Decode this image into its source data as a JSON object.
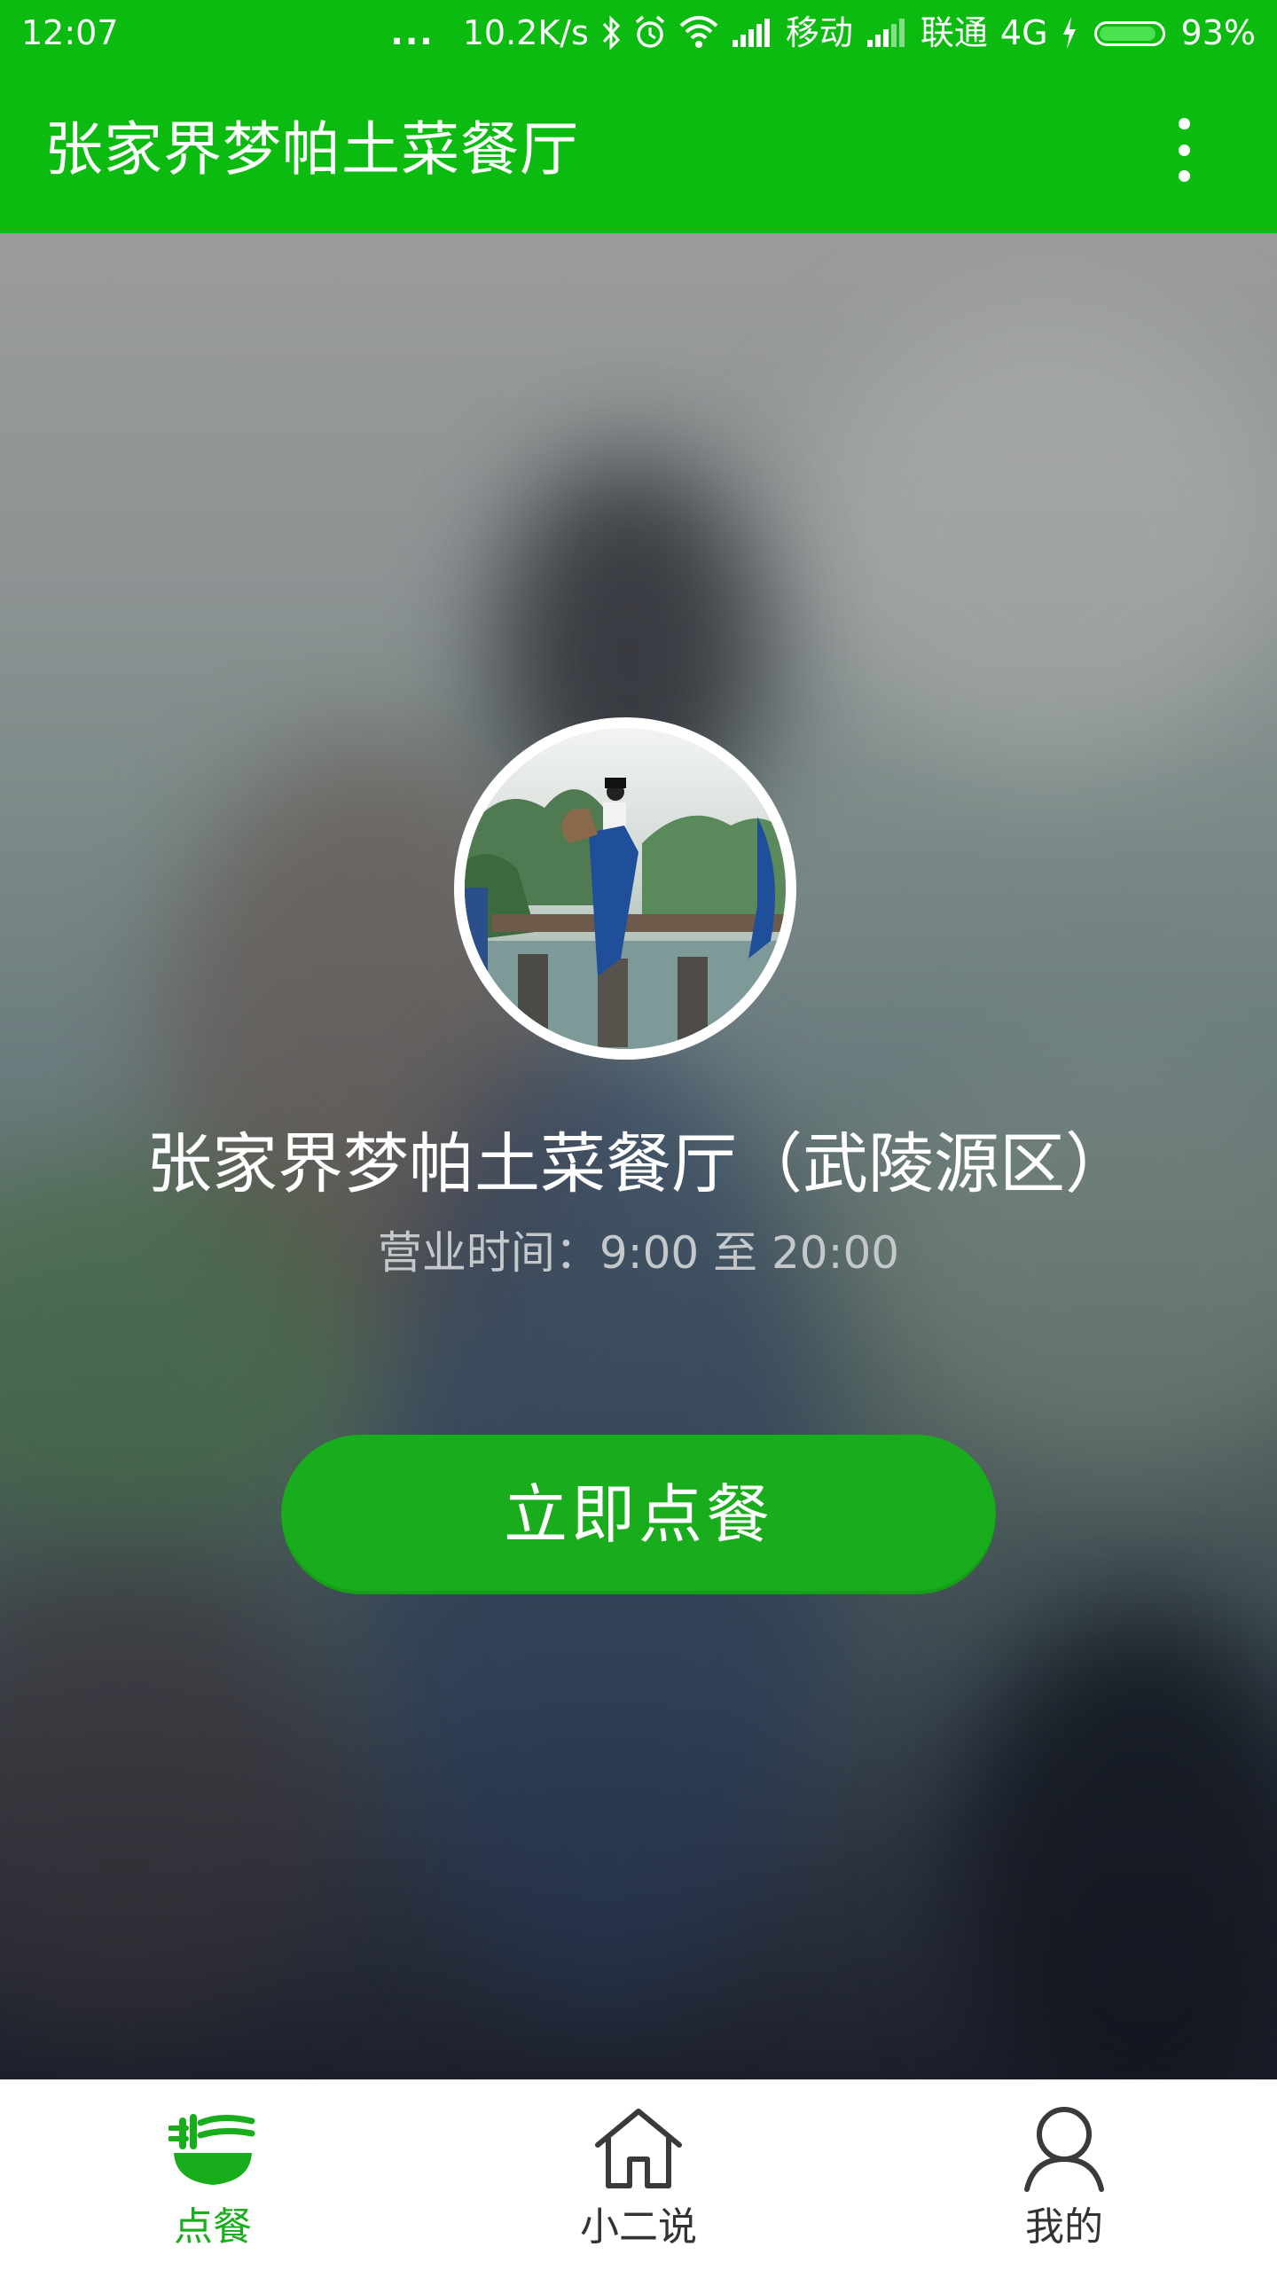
{
  "status_bar": {
    "time": "12:07",
    "dots": "...",
    "speed": "10.2K/s",
    "carrier1": "移动",
    "carrier2": "联通",
    "network": "4G",
    "battery_percent": "93%",
    "battery_level": 0.93,
    "icons": [
      "bluetooth-icon",
      "alarm-icon",
      "wifi-icon",
      "signal-icon",
      "charging-icon",
      "battery-icon"
    ]
  },
  "app_bar": {
    "title": "张家界梦帕土菜餐厅",
    "more_icon": "more-vert-icon"
  },
  "hero": {
    "store_name": "张家界梦帕土菜餐厅（武陵源区）",
    "hours": "营业时间：9:00 至 20:00",
    "order_button": "立即点餐"
  },
  "bottom_nav": {
    "items": [
      {
        "label": "点餐",
        "icon": "noodle-bowl-icon",
        "active": true
      },
      {
        "label": "小二说",
        "icon": "home-icon",
        "active": false
      },
      {
        "label": "我的",
        "icon": "person-icon",
        "active": false
      }
    ]
  },
  "colors": {
    "brand_green": "#0bbb0f",
    "button_green": "#19ac1c",
    "nav_active": "#19ac1c",
    "nav_inactive": "#333333"
  }
}
